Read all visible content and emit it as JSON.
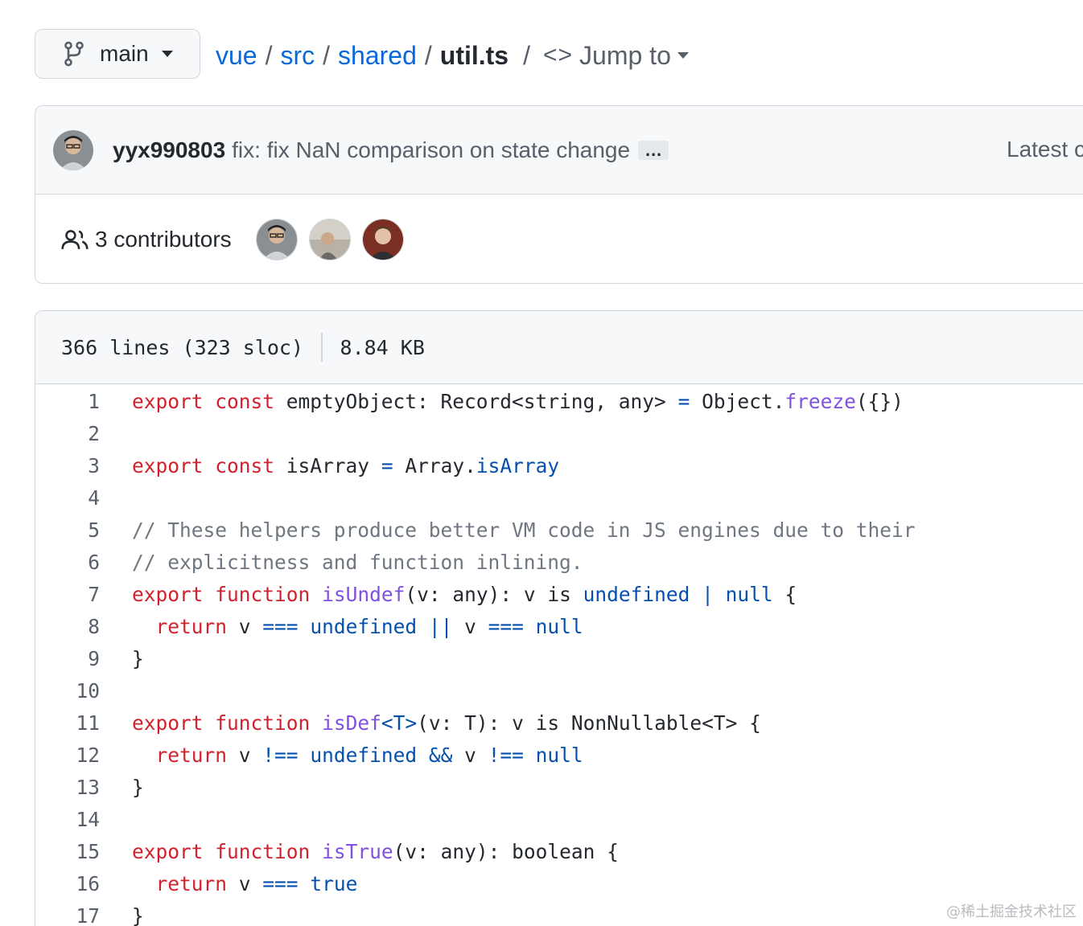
{
  "branch": {
    "icon": "git-branch-icon",
    "label": "main"
  },
  "breadcrumb": {
    "repo": "vue",
    "sep": "/",
    "dir1": "src",
    "dir2": "shared",
    "file": "util.ts",
    "jump_label": "Jump to",
    "code_icon": "<>"
  },
  "commit": {
    "author": "yyx990803",
    "message": "fix: fix NaN comparison on state change",
    "ellipsis": "…",
    "latest_label": "Latest c"
  },
  "contributors": {
    "label": "3 contributors"
  },
  "file_info": {
    "lines": "366 lines (323 sloc)",
    "size": "8.84 KB"
  },
  "code_lines": [
    {
      "n": "1"
    },
    {
      "n": "2"
    },
    {
      "n": "3"
    },
    {
      "n": "4"
    },
    {
      "n": "5"
    },
    {
      "n": "6"
    },
    {
      "n": "7"
    },
    {
      "n": "8"
    },
    {
      "n": "9"
    },
    {
      "n": "10"
    },
    {
      "n": "11"
    },
    {
      "n": "12"
    },
    {
      "n": "13"
    },
    {
      "n": "14"
    },
    {
      "n": "15"
    },
    {
      "n": "16"
    },
    {
      "n": "17"
    }
  ],
  "code_tokens": {
    "l1": [
      "export",
      " ",
      "const",
      " emptyObject: Record<string, any> ",
      "=",
      " Object.",
      "freeze",
      "({})"
    ],
    "l3": [
      "export",
      " ",
      "const",
      " isArray ",
      "=",
      " Array.",
      "isArray"
    ],
    "l5": [
      "// These helpers produce better VM code in JS engines due to their"
    ],
    "l6": [
      "// explicitness and function inlining."
    ],
    "l7": [
      "export",
      " ",
      "function",
      " ",
      "isUndef",
      "(v: any): v is ",
      "undefined",
      " ",
      "|",
      " ",
      "null",
      " {"
    ],
    "l8": [
      "  ",
      "return",
      " v ",
      "===",
      " ",
      "undefined",
      " ",
      "||",
      " v ",
      "===",
      " ",
      "null"
    ],
    "l9": [
      "}"
    ],
    "l11": [
      "export",
      " ",
      "function",
      " ",
      "isDef",
      "<T>",
      "(v: T): v is NonNullable<T> {"
    ],
    "l12": [
      "  ",
      "return",
      " v ",
      "!==",
      " ",
      "undefined",
      " ",
      "&&",
      " v ",
      "!==",
      " ",
      "null"
    ],
    "l13": [
      "}"
    ],
    "l15": [
      "export",
      " ",
      "function",
      " ",
      "isTrue",
      "(v: any): boolean {"
    ],
    "l16": [
      "  ",
      "return",
      " v ",
      "===",
      " ",
      "true"
    ],
    "l17": [
      "}"
    ]
  },
  "watermark": "@稀土掘金技术社区",
  "colors": {
    "link": "#0969da",
    "keyword": "#cf222e",
    "function": "#8250df",
    "comment": "#6e7781",
    "constant": "#0550ae"
  }
}
